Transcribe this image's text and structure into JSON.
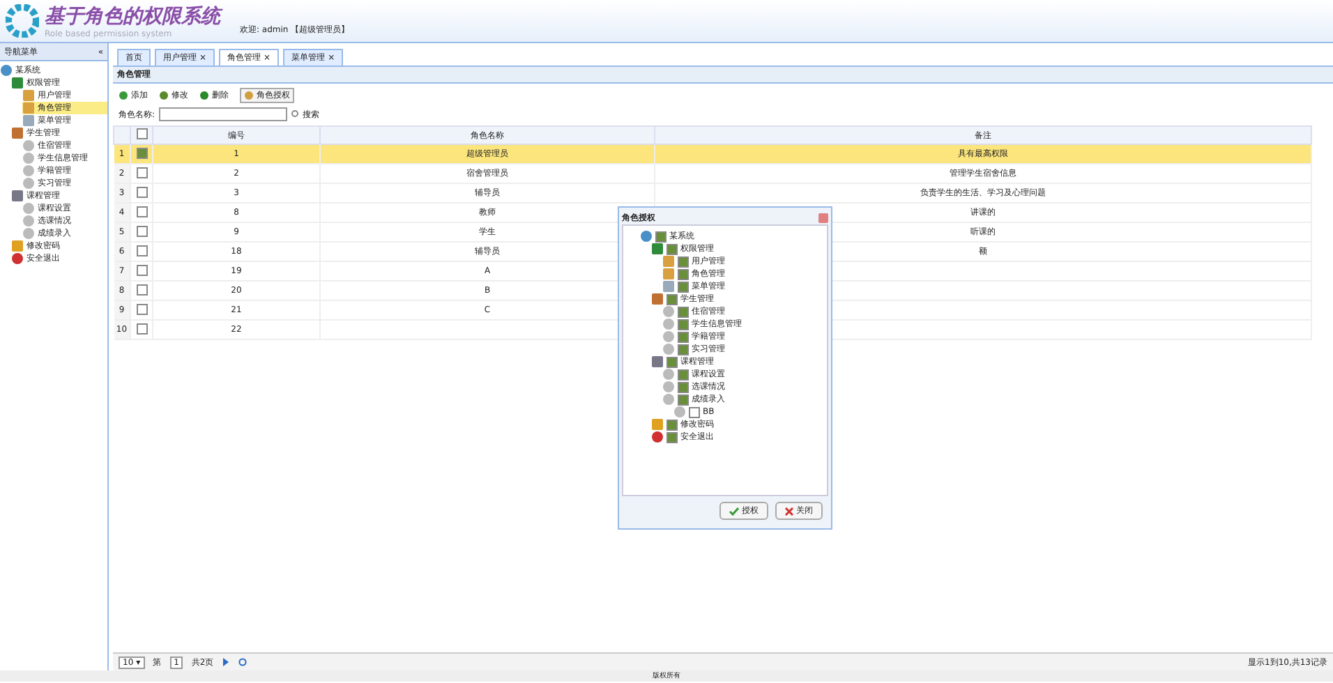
{
  "header": {
    "logo_title": "基于角色的权限系统",
    "logo_subtitle": "Role based permission system",
    "welcome": "欢迎: admin 【超级管理员】"
  },
  "sidebar": {
    "title": "导航菜单",
    "collapse": "«",
    "tree": [
      {
        "label": "某系统",
        "kind": "system",
        "selected": false,
        "children": [
          {
            "label": "权限管理",
            "kind": "folder",
            "selected": false,
            "children": [
              {
                "label": "用户管理",
                "kind": "user",
                "selected": false
              },
              {
                "label": "角色管理",
                "kind": "user",
                "selected": true
              },
              {
                "label": "菜单管理",
                "kind": "page",
                "selected": false
              }
            ]
          },
          {
            "label": "学生管理",
            "kind": "group",
            "selected": false,
            "children": [
              {
                "label": "住宿管理",
                "kind": "leaf",
                "selected": false
              },
              {
                "label": "学生信息管理",
                "kind": "leaf",
                "selected": false
              },
              {
                "label": "学籍管理",
                "kind": "leaf",
                "selected": false
              },
              {
                "label": "实习管理",
                "kind": "leaf",
                "selected": false
              }
            ]
          },
          {
            "label": "课程管理",
            "kind": "grid",
            "selected": false,
            "children": [
              {
                "label": "课程设置",
                "kind": "leaf",
                "selected": false
              },
              {
                "label": "选课情况",
                "kind": "leaf",
                "selected": false
              },
              {
                "label": "成绩录入",
                "kind": "leaf",
                "selected": false
              }
            ]
          },
          {
            "label": "修改密码",
            "kind": "key",
            "selected": false
          },
          {
            "label": "安全退出",
            "kind": "exit",
            "selected": false
          }
        ]
      }
    ]
  },
  "tabs": [
    {
      "label": "首页",
      "selected": false
    },
    {
      "label": "用户管理",
      "close": "×",
      "selected": false
    },
    {
      "label": "角色管理",
      "close": "×",
      "selected": true
    },
    {
      "label": "菜单管理",
      "close": "×",
      "selected": false
    }
  ],
  "panel": {
    "title": "角色管理",
    "toolbar": [
      {
        "label": "添加",
        "kind": "add"
      },
      {
        "label": "修改",
        "kind": "edit"
      },
      {
        "label": "删除",
        "kind": "delete"
      },
      {
        "label": "角色授权",
        "kind": "grant"
      }
    ],
    "search": {
      "label": "角色名称:",
      "button": "搜索"
    },
    "table": {
      "all_checked": false,
      "columns": [
        "编号",
        "角色名称",
        "备注"
      ],
      "rows": [
        {
          "index": "1",
          "checked": true,
          "selected": true,
          "cells": [
            "1",
            "超级管理员",
            "具有最高权限"
          ]
        },
        {
          "index": "2",
          "checked": false,
          "selected": false,
          "cells": [
            "2",
            "宿舍管理员",
            "管理学生宿舍信息"
          ]
        },
        {
          "index": "3",
          "checked": false,
          "selected": false,
          "cells": [
            "3",
            "辅导员",
            "负责学生的生活、学习及心理问题"
          ]
        },
        {
          "index": "4",
          "checked": false,
          "selected": false,
          "cells": [
            "8",
            "教师",
            "讲课的"
          ]
        },
        {
          "index": "5",
          "checked": false,
          "selected": false,
          "cells": [
            "9",
            "学生",
            "听课的"
          ]
        },
        {
          "index": "6",
          "checked": false,
          "selected": false,
          "cells": [
            "18",
            "辅导员",
            "额"
          ]
        },
        {
          "index": "7",
          "checked": false,
          "selected": false,
          "cells": [
            "19",
            "A",
            ""
          ]
        },
        {
          "index": "8",
          "checked": false,
          "selected": false,
          "cells": [
            "20",
            "B",
            ""
          ]
        },
        {
          "index": "9",
          "checked": false,
          "selected": false,
          "cells": [
            "21",
            "C",
            ""
          ]
        },
        {
          "index": "10",
          "checked": false,
          "selected": false,
          "cells": [
            "22",
            "",
            ""
          ]
        }
      ]
    },
    "pager": {
      "page_size": "10",
      "page_size_caret": "▾",
      "page_prefix": "第",
      "page": "1",
      "page_suffix": "共2页",
      "summary": "显示1到10,共13记录"
    }
  },
  "dialog": {
    "title": "角色授权",
    "tree": [
      {
        "label": "某系统",
        "kind": "system",
        "checked": true,
        "children": [
          {
            "label": "权限管理",
            "kind": "folder",
            "checked": true,
            "children": [
              {
                "label": "用户管理",
                "kind": "user",
                "checked": true
              },
              {
                "label": "角色管理",
                "kind": "user",
                "checked": true
              },
              {
                "label": "菜单管理",
                "kind": "page",
                "checked": true
              }
            ]
          },
          {
            "label": "学生管理",
            "kind": "group",
            "checked": true,
            "children": [
              {
                "label": "住宿管理",
                "kind": "leaf",
                "checked": true
              },
              {
                "label": "学生信息管理",
                "kind": "leaf",
                "checked": true
              },
              {
                "label": "学籍管理",
                "kind": "leaf",
                "checked": true
              },
              {
                "label": "实习管理",
                "kind": "leaf",
                "checked": true
              }
            ]
          },
          {
            "label": "课程管理",
            "kind": "grid",
            "checked": true,
            "children": [
              {
                "label": "课程设置",
                "kind": "leaf",
                "checked": true
              },
              {
                "label": "选课情况",
                "kind": "leaf",
                "checked": true
              },
              {
                "label": "成绩录入",
                "kind": "leaf",
                "checked": true,
                "children": [
                  {
                    "label": "BB",
                    "kind": "leaf",
                    "checked": false
                  }
                ]
              }
            ]
          },
          {
            "label": "修改密码",
            "kind": "key",
            "checked": true
          },
          {
            "label": "安全退出",
            "kind": "exit",
            "checked": true
          }
        ]
      }
    ],
    "buttons": [
      {
        "label": "授权",
        "kind": "ok"
      },
      {
        "label": "关闭",
        "kind": "close"
      }
    ]
  },
  "footer": "版权所有"
}
